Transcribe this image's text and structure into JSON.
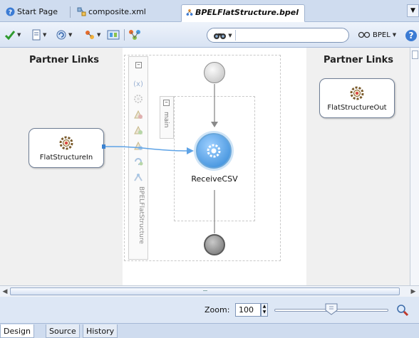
{
  "tabs": [
    {
      "label": "Start Page",
      "icon": "help-circle-icon",
      "active": false
    },
    {
      "label": "composite.xml",
      "icon": "composite-icon",
      "active": false
    },
    {
      "label": "BPELFlatStructure.bpel",
      "icon": "bpel-process-icon",
      "active": true
    }
  ],
  "toolbar": {
    "search_placeholder": "",
    "bpel_label": "BPEL",
    "icons": [
      "validate-check-icon",
      "bookmark-icon",
      "refresh-icon",
      "deploy-icon",
      "diagram-icon",
      "layout-icon"
    ]
  },
  "canvas": {
    "left_title": "Partner Links",
    "right_title": "Partner Links",
    "left_partner": "FlatStructureIn",
    "right_partner": "FlatStructureOut",
    "process_label": "BPELFlatStructure",
    "sequence_label": "main",
    "activity_label": "ReceiveCSV"
  },
  "zoom": {
    "label": "Zoom:",
    "value": "100",
    "level_fraction": 0.5
  },
  "bottom_tabs": [
    {
      "label": "Design",
      "active": true
    },
    {
      "label": "Source",
      "active": false
    },
    {
      "label": "History",
      "active": false
    }
  ],
  "colors": {
    "accent": "#2f86d6",
    "link_line": "#5ea3e6",
    "panel_bg": "#dfe8f6"
  }
}
